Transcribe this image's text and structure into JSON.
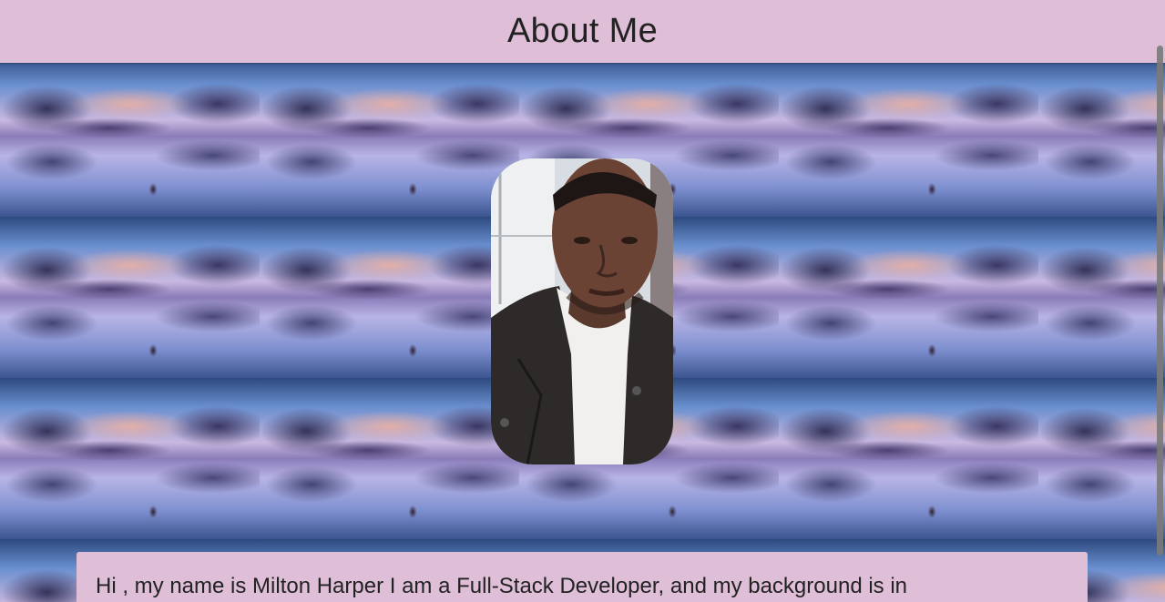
{
  "header": {
    "title": "About Me"
  },
  "profile_photo": {
    "icon": "profile-photo"
  },
  "bio": {
    "text": "Hi , my name is Milton Harper I am a Full-Stack Developer, and my background is in"
  },
  "colors": {
    "header_bg": "#dfbfd7",
    "text": "#222222"
  }
}
